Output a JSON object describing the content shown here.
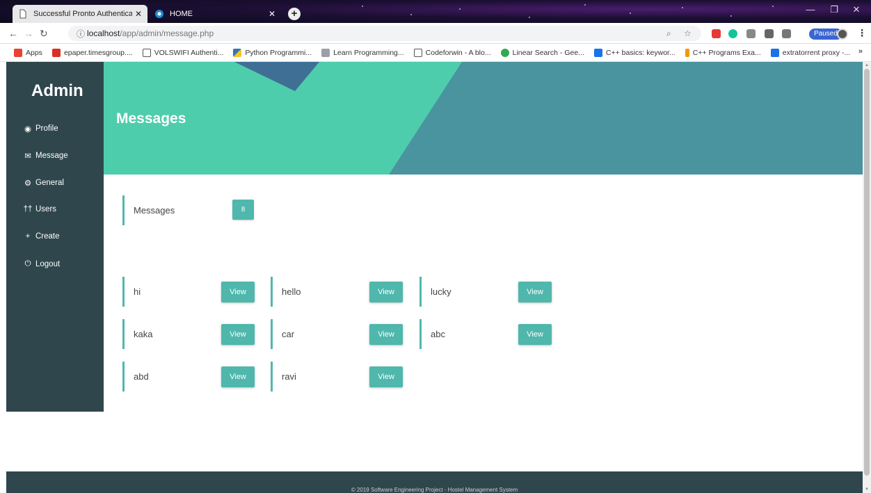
{
  "browser": {
    "tabs": [
      {
        "title": "Successful Pronto Authentication",
        "active": false
      },
      {
        "title": "HOME",
        "active": true
      }
    ],
    "url_host": "localhost",
    "url_path": "/app/admin/message.php",
    "paused_label": "Paused",
    "bookmarks": [
      {
        "label": "Apps",
        "color": "#e94235"
      },
      {
        "label": "epaper.timesgroup....",
        "color": "#d93025"
      },
      {
        "label": "VOLSWIFI Authenti...",
        "color": "#ffffff"
      },
      {
        "label": "Python Programmi...",
        "color": "#f4c430"
      },
      {
        "label": "Learn Programming...",
        "color": "#9aa0a6"
      },
      {
        "label": "Codeforwin - A blo...",
        "color": "#ffffff"
      },
      {
        "label": "Linear Search - Gee...",
        "color": "#34a853"
      },
      {
        "label": "C++ basics: keywor...",
        "color": "#1a73e8"
      },
      {
        "label": "C++ Programs Exa...",
        "color": "#f29900"
      },
      {
        "label": "extratorrent proxy -...",
        "color": "#1a73e8"
      }
    ],
    "bookmarks_more": "»"
  },
  "sidebar": {
    "brand": "Admin",
    "items": [
      {
        "label": "Profile",
        "icon": "user-circle-icon",
        "glyph": "◉"
      },
      {
        "label": "Message",
        "icon": "envelope-open-icon",
        "glyph": "✉"
      },
      {
        "label": "General",
        "icon": "cog-icon",
        "glyph": "⚙"
      },
      {
        "label": "Users",
        "icon": "users-icon",
        "glyph": "††"
      },
      {
        "label": "Create",
        "icon": "plus-icon",
        "glyph": "+"
      },
      {
        "label": "Logout",
        "icon": "power-icon",
        "glyph": "⏻"
      }
    ]
  },
  "header": {
    "title": "Messages"
  },
  "summary": {
    "label": "Messages",
    "count": "8"
  },
  "messages": [
    {
      "name": "hi",
      "button": "View"
    },
    {
      "name": "hello",
      "button": "View"
    },
    {
      "name": "lucky",
      "button": "View"
    },
    {
      "name": "kaka",
      "button": "View"
    },
    {
      "name": "car",
      "button": "View"
    },
    {
      "name": "abc",
      "button": "View"
    },
    {
      "name": "abd",
      "button": "View"
    },
    {
      "name": "ravi",
      "button": "View"
    }
  ],
  "footer": {
    "text": "© 2019 Software Engineering Project - Hostel Management System"
  },
  "colors": {
    "accent": "#4fb7ac",
    "sidebar": "#2f464d",
    "banner_teal": "#4a949f",
    "banner_green": "#4ecdad"
  }
}
